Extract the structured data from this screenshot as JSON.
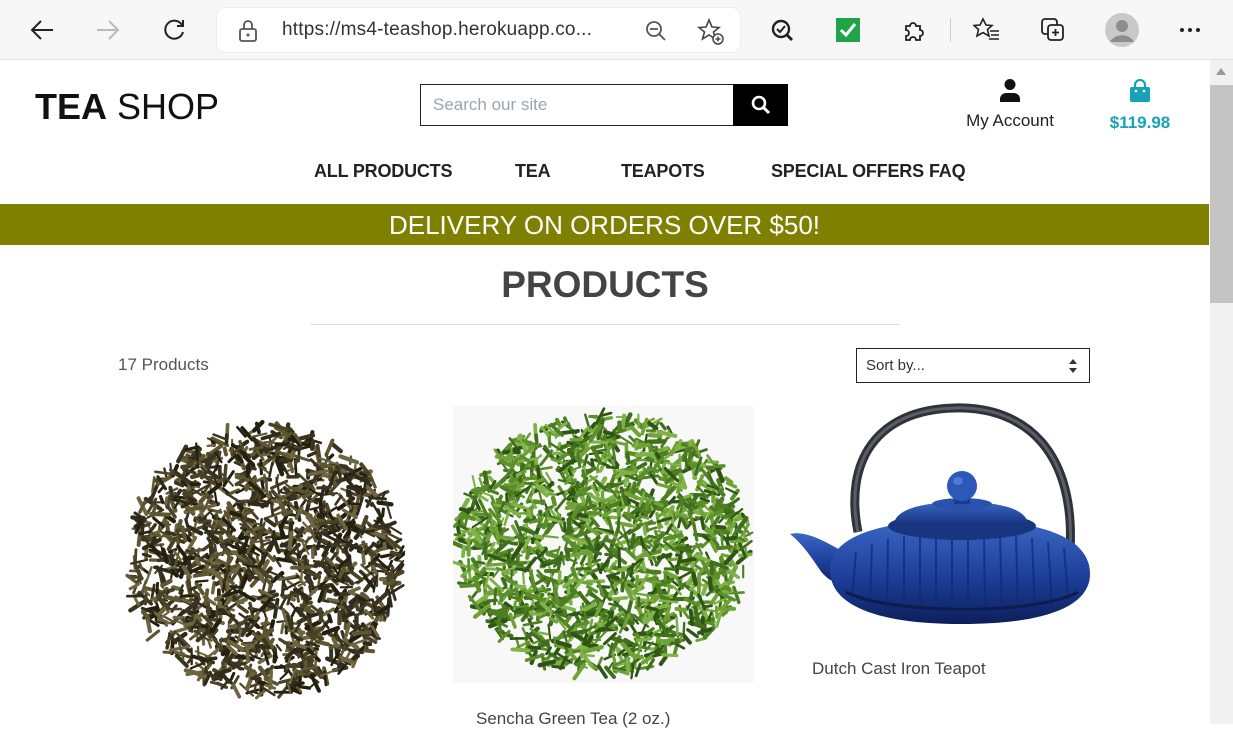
{
  "browser": {
    "url": "https://ms4-teashop.herokuapp.co...",
    "icons": [
      "back-icon",
      "forward-icon",
      "refresh-icon",
      "lock-icon",
      "zoom-out-icon",
      "add-favorite-icon",
      "tracking-extension-icon",
      "checkmark-extension-icon",
      "extensions-icon",
      "favorites-icon",
      "collections-icon",
      "profile-avatar-icon",
      "more-menu-icon"
    ]
  },
  "header": {
    "logo_bold": "TEA",
    "logo_rest": " SHOP",
    "search_placeholder": "Search our site",
    "account_label": "My Account",
    "cart_total": "$119.98"
  },
  "nav": {
    "items": [
      "ALL PRODUCTS",
      "TEA",
      "TEAPOTS",
      "SPECIAL OFFERS",
      "FAQ"
    ]
  },
  "banner": {
    "text": "DELIVERY ON ORDERS OVER $50!"
  },
  "main": {
    "title": "PRODUCTS",
    "product_count": "17 Products",
    "sort_label": "Sort by..."
  },
  "products": [
    {
      "name": "",
      "image": "loose-dark-tea-leaves"
    },
    {
      "name": "Sencha Green Tea (2 oz.)",
      "image": "loose-green-tea-leaves"
    },
    {
      "name": "Dutch Cast Iron Teapot",
      "image": "blue-cast-iron-teapot"
    }
  ],
  "colors": {
    "banner": "#808000",
    "cart_accent": "#17a2b8",
    "heading_text": "#444444"
  }
}
